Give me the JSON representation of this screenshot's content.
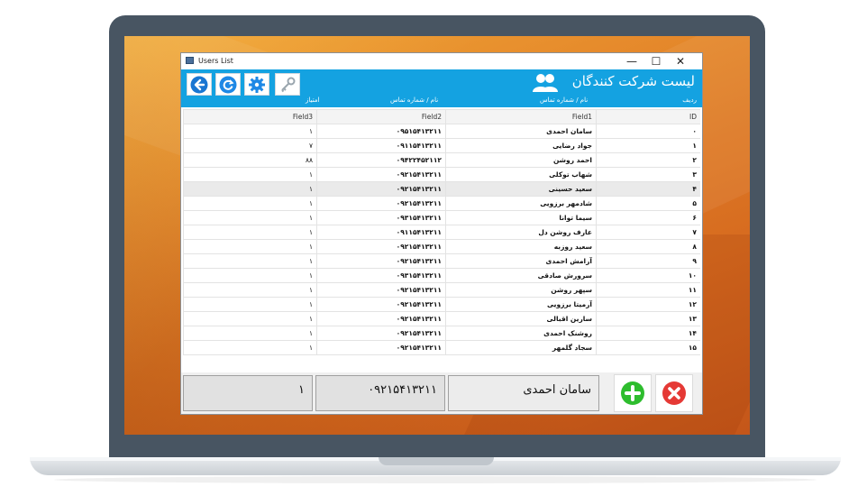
{
  "window": {
    "title": "Users List",
    "minimize": "—",
    "maximize": "☐",
    "close": "✕"
  },
  "header": {
    "title": "لیست شرکت کنندگان",
    "col_row": "ردیف",
    "col_name": "نام / شماره تماس",
    "col_name2": "نام / شماره تماس",
    "col_score": "امتیاز"
  },
  "toolbar": {
    "back_icon": "back-arrow-icon",
    "refresh_icon": "refresh-icon",
    "settings_icon": "gear-icon",
    "key_icon": "key-icon"
  },
  "grid": {
    "columns": [
      "Field3",
      "Field2",
      "Field1",
      "ID"
    ],
    "rows": [
      {
        "field3": "۱",
        "field2": "۰۹۵۱۵۴۱۳۲۱۱",
        "field1": "سامان احمدی",
        "id": "۰"
      },
      {
        "field3": "۷",
        "field2": "۰۹۱۱۵۴۱۳۲۱۱",
        "field1": "جواد رضایی",
        "id": "۱"
      },
      {
        "field3": "۸۸",
        "field2": "۰۹۴۲۲۴۵۲۱۱۲",
        "field1": "احمد روشن",
        "id": "۲"
      },
      {
        "field3": "۱",
        "field2": "۰۹۲۱۵۴۱۳۲۱۱",
        "field1": "شهاب توکلی",
        "id": "۳"
      },
      {
        "field3": "۱",
        "field2": "۰۹۲۱۵۴۱۳۲۱۱",
        "field1": "سعید حسینی",
        "id": "۴"
      },
      {
        "field3": "۱",
        "field2": "۰۹۲۱۵۴۱۳۲۱۱",
        "field1": "شادمهر برزویی",
        "id": "۵"
      },
      {
        "field3": "۱",
        "field2": "۰۹۳۱۵۴۱۳۲۱۱",
        "field1": "سیما توانا",
        "id": "۶"
      },
      {
        "field3": "۱",
        "field2": "۰۹۱۱۵۴۱۳۲۱۱",
        "field1": "عارف روشن دل",
        "id": "۷"
      },
      {
        "field3": "۱",
        "field2": "۰۹۲۱۵۴۱۳۲۱۱",
        "field1": "سعید روزبه",
        "id": "۸"
      },
      {
        "field3": "۱",
        "field2": "۰۹۲۱۵۴۱۳۲۱۱",
        "field1": "آرامش احمدی",
        "id": "۹"
      },
      {
        "field3": "۱",
        "field2": "۰۹۳۱۵۴۱۳۲۱۱",
        "field1": "سرورش صادقی",
        "id": "۱۰"
      },
      {
        "field3": "۱",
        "field2": "۰۹۲۱۵۴۱۳۲۱۱",
        "field1": "سپهر روشن",
        "id": "۱۱"
      },
      {
        "field3": "۱",
        "field2": "۰۹۲۱۵۴۱۳۲۱۱",
        "field1": "آرمیتا برزویی",
        "id": "۱۲"
      },
      {
        "field3": "۱",
        "field2": "۰۹۲۱۵۴۱۳۲۱۱",
        "field1": "سارین اقبالی",
        "id": "۱۳"
      },
      {
        "field3": "۱",
        "field2": "۰۹۲۱۵۴۱۳۲۱۱",
        "field1": "روشنک احمدی",
        "id": "۱۴"
      },
      {
        "field3": "۱",
        "field2": "۰۹۲۱۵۴۱۳۲۱۱",
        "field1": "سجاد گلمهر",
        "id": "۱۵"
      }
    ]
  },
  "form": {
    "score_value": "۱",
    "phone_value": "۰۹۲۱۵۴۱۳۲۱۱",
    "name_value": "سامان احمدی",
    "add_icon": "add-icon",
    "delete_icon": "delete-icon"
  },
  "colors": {
    "accent": "#14a2e1",
    "add": "#2ebd2e",
    "delete": "#e53935"
  }
}
